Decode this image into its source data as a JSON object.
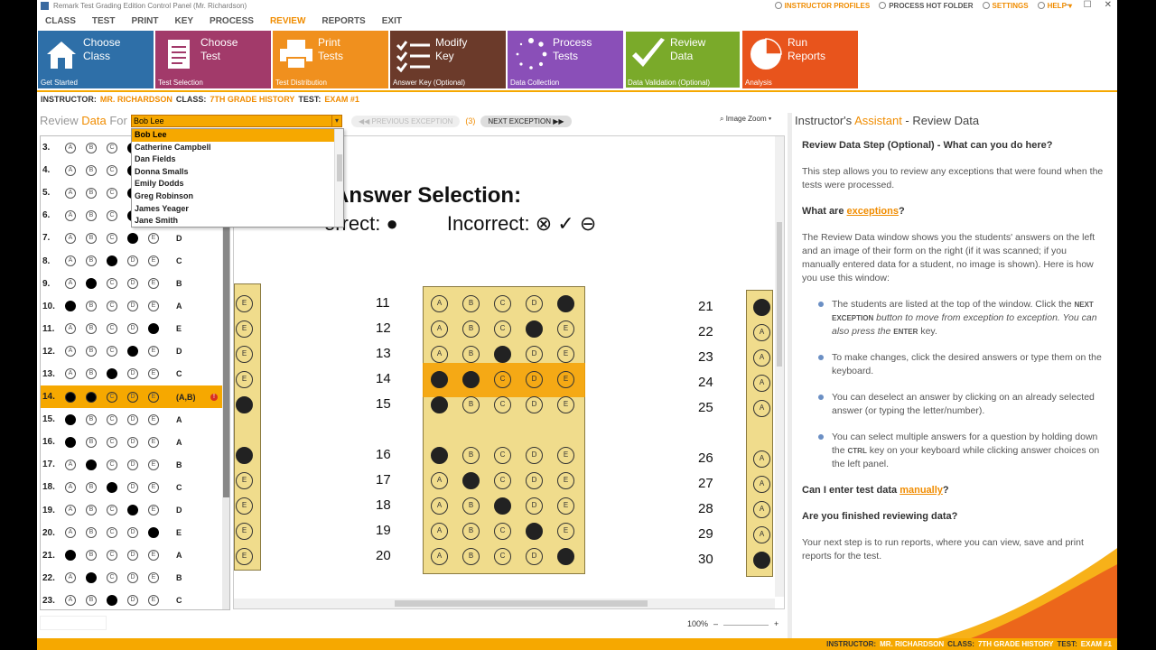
{
  "window": {
    "title": "Remark Test Grading Edition Control Panel (Mr. Richardson)",
    "min": "–",
    "max": "☐",
    "close": "✕"
  },
  "top_links": [
    {
      "label": "INSTRUCTOR PROFILES",
      "active": true
    },
    {
      "label": "PROCESS HOT FOLDER",
      "active": false
    },
    {
      "label": "SETTINGS",
      "active": true
    },
    {
      "label": "HELP ▾",
      "active": true
    }
  ],
  "menu": [
    "CLASS",
    "TEST",
    "PRINT",
    "KEY",
    "PROCESS",
    "REVIEW",
    "REPORTS",
    "EXIT"
  ],
  "active_menu": "REVIEW",
  "tiles": [
    {
      "title": "Choose\nClass",
      "sub": "Get Started",
      "color": "#2e6fa8",
      "icon": "house-icon"
    },
    {
      "title": "Choose\nTest",
      "sub": "Test Selection",
      "color": "#a23a6a",
      "icon": "document-icon"
    },
    {
      "title": "Print\nTests",
      "sub": "Test Distribution",
      "color": "#f0901e",
      "icon": "printer-icon"
    },
    {
      "title": "Modify\nKey",
      "sub": "Answer Key (Optional)",
      "color": "#6b3a2a",
      "icon": "checklist-icon"
    },
    {
      "title": "Process\nTests",
      "sub": "Data Collection",
      "color": "#8a4fb8",
      "icon": "spinner-icon"
    },
    {
      "title": "Review\nData",
      "sub": "Data Validation (Optional)",
      "color": "#7aaa2a",
      "icon": "checkmark-icon"
    },
    {
      "title": "Run\nReports",
      "sub": "Analysis",
      "color": "#e8541c",
      "icon": "pie-chart-icon"
    }
  ],
  "info": {
    "instructor_label": "INSTRUCTOR:",
    "instructor": "MR. RICHARDSON",
    "class_label": "CLASS:",
    "class": "7TH GRADE HISTORY",
    "test_label": "TEST:",
    "test": "EXAM #1"
  },
  "review": {
    "label_a": "Review ",
    "label_b": "Data",
    "label_c": " For",
    "selected_student": "Bob Lee"
  },
  "students": [
    "Bob Lee",
    "Catherine Campbell",
    "Dan Fields",
    "Donna Smalls",
    "Emily Dodds",
    "Greg Robinson",
    "James Yeager",
    "Jane Smith"
  ],
  "nav": {
    "prev": "◀◀  PREVIOUS EXCEPTION",
    "count": "(3)",
    "next": "NEXT EXCEPTION  ▶▶",
    "zoom": "Image Zoom ▾"
  },
  "choices": [
    "A",
    "B",
    "C",
    "D",
    "E"
  ],
  "questions": [
    {
      "n": "3.",
      "filled": [
        3
      ],
      "ans": ""
    },
    {
      "n": "4.",
      "filled": [
        3
      ],
      "ans": ""
    },
    {
      "n": "5.",
      "filled": [
        3
      ],
      "ans": ""
    },
    {
      "n": "6.",
      "filled": [
        3
      ],
      "ans": ""
    },
    {
      "n": "7.",
      "filled": [
        3
      ],
      "ans": "D"
    },
    {
      "n": "8.",
      "filled": [
        2
      ],
      "ans": "C"
    },
    {
      "n": "9.",
      "filled": [
        1
      ],
      "ans": "B"
    },
    {
      "n": "10.",
      "filled": [
        0
      ],
      "ans": "A"
    },
    {
      "n": "11.",
      "filled": [
        4
      ],
      "ans": "E"
    },
    {
      "n": "12.",
      "filled": [
        3
      ],
      "ans": "D"
    },
    {
      "n": "13.",
      "filled": [
        2
      ],
      "ans": "C"
    },
    {
      "n": "14.",
      "filled": [
        0,
        1
      ],
      "ans": "(A,B)",
      "exception": true
    },
    {
      "n": "15.",
      "filled": [
        0
      ],
      "ans": "A"
    },
    {
      "n": "16.",
      "filled": [
        0
      ],
      "ans": "A"
    },
    {
      "n": "17.",
      "filled": [
        1
      ],
      "ans": "B"
    },
    {
      "n": "18.",
      "filled": [
        2
      ],
      "ans": "C"
    },
    {
      "n": "19.",
      "filled": [
        3
      ],
      "ans": "D"
    },
    {
      "n": "20.",
      "filled": [
        4
      ],
      "ans": "E"
    },
    {
      "n": "21.",
      "filled": [
        0
      ],
      "ans": "A"
    },
    {
      "n": "22.",
      "filled": [
        1
      ],
      "ans": "B"
    },
    {
      "n": "23.",
      "filled": [
        2
      ],
      "ans": "C"
    }
  ],
  "sheet": {
    "heading": "Answer Selection:",
    "correct": "orrect:",
    "incorrect": "Incorrect:",
    "mid_items": [
      {
        "n": "11",
        "filled": [
          4
        ]
      },
      {
        "n": "12",
        "filled": [
          3
        ]
      },
      {
        "n": "13",
        "filled": [
          2
        ]
      },
      {
        "n": "14",
        "filled": [
          0,
          1
        ]
      },
      {
        "n": "15",
        "filled": [
          0
        ]
      },
      {
        "n": "16",
        "filled": [
          0
        ]
      },
      {
        "n": "17",
        "filled": [
          1
        ]
      },
      {
        "n": "18",
        "filled": [
          2
        ]
      },
      {
        "n": "19",
        "filled": [
          3
        ]
      },
      {
        "n": "20",
        "filled": [
          4
        ]
      }
    ],
    "right_nums": [
      "21",
      "22",
      "23",
      "24",
      "25",
      "26",
      "27",
      "28",
      "29",
      "30"
    ]
  },
  "zoom_level": "100%",
  "assistant": {
    "title_a": "Instructor's ",
    "title_b": "Assistant",
    "title_c": " - Review Data",
    "h1": "Review Data Step (Optional) - What can you do here?",
    "p1": "This step allows you to review any exceptions that were found when the tests were processed.",
    "h2a": "What are ",
    "h2link": "exceptions",
    "h2b": "?",
    "p2": "The Review Data window shows you the students' answers on the left and an image of their form on the right (if it was scanned; if you manually entered data for a student, no image is shown). Here is how you use this window:",
    "b1a": "The students are listed at the top of the window. Click the ",
    "b1sc": "NEXT EXCEPTION",
    "b1b": " button to move from exception to exception. You can also press the ",
    "b1sc2": "ENTER",
    "b1c": " key.",
    "b2": "To make changes, click the desired answers or type them on the keyboard.",
    "b3": "You can deselect an answer by clicking on an already selected answer (or typing the letter/number).",
    "b4a": "You can select multiple answers for a question by holding down the ",
    "b4sc": "CTRL",
    "b4b": " key on your keyboard while clicking answer choices on the left panel.",
    "h3a": "Can I enter test data ",
    "h3link": "manually",
    "h3b": "?",
    "h4": "Are you finished reviewing data?",
    "p4": "Your next step is to run reports, where you can view, save and print reports for the test."
  },
  "status": {
    "instructor_label": "INSTRUCTOR:",
    "instructor": "MR. RICHARDSON",
    "class_label": "CLASS:",
    "class": "7TH GRADE HISTORY",
    "test_label": "TEST:",
    "test": "EXAM #1"
  }
}
